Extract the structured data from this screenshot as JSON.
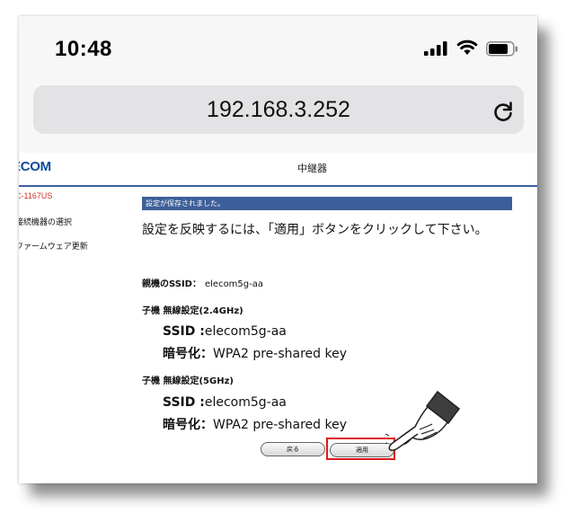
{
  "status_bar": {
    "time": "10:48"
  },
  "browser": {
    "url": "192.168.3.252"
  },
  "web": {
    "logo": "ECOM",
    "page_title": "中継器",
    "sidebar": {
      "model": "C-1167US",
      "item1": "接続機器の選択",
      "item2": "ファームウェア更新"
    },
    "banner": "設定が保存されました。",
    "message": "設定を反映するには、「適用」ボタンをクリックして下さい。",
    "parent_ssid_label": "親機のSSID：",
    "parent_ssid_value": "elecom5g-aa",
    "child_24_heading": "子機 無線設定(2.4GHz)",
    "child_24": {
      "ssid_label": "SSID :",
      "ssid_value": "elecom5g-aa",
      "enc_label": "暗号化：",
      "enc_value": "WPA2 pre-shared key"
    },
    "child_5_heading": "子機 無線設定(5GHz)",
    "child_5": {
      "ssid_label": "SSID :",
      "ssid_value": "elecom5g-aa",
      "enc_label": "暗号化：",
      "enc_value": "WPA2 pre-shared key"
    },
    "buttons": {
      "back": "戻る",
      "apply": "適用"
    }
  },
  "icons": [
    "signal-icon",
    "wifi-icon",
    "battery-icon",
    "reload-icon",
    "pointing-hand-icon"
  ]
}
